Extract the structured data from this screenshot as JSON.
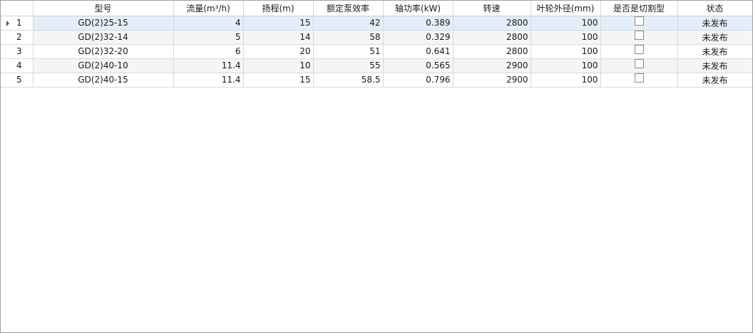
{
  "columns": [
    "",
    "型号",
    "流量(m³/h)",
    "扬程(m)",
    "额定泵效率",
    "轴功率(kW)",
    "转速",
    "叶轮外径(mm)",
    "是否是切割型",
    "状态"
  ],
  "rows": [
    {
      "index": "1",
      "model": "GD(2)25-15",
      "flow": "4",
      "head": "15",
      "efficiency": "42",
      "power": "0.389",
      "speed": "2800",
      "diameter": "100",
      "is_cut": false,
      "status": "未发布"
    },
    {
      "index": "2",
      "model": "GD(2)32-14",
      "flow": "5",
      "head": "14",
      "efficiency": "58",
      "power": "0.329",
      "speed": "2800",
      "diameter": "100",
      "is_cut": false,
      "status": "未发布"
    },
    {
      "index": "3",
      "model": "GD(2)32-20",
      "flow": "6",
      "head": "20",
      "efficiency": "51",
      "power": "0.641",
      "speed": "2800",
      "diameter": "100",
      "is_cut": false,
      "status": "未发布"
    },
    {
      "index": "4",
      "model": "GD(2)40-10",
      "flow": "11.4",
      "head": "10",
      "efficiency": "55",
      "power": "0.565",
      "speed": "2900",
      "diameter": "100",
      "is_cut": false,
      "status": "未发布"
    },
    {
      "index": "5",
      "model": "GD(2)40-15",
      "flow": "11.4",
      "head": "15",
      "efficiency": "58.5",
      "power": "0.796",
      "speed": "2900",
      "diameter": "100",
      "is_cut": false,
      "status": "未发布"
    }
  ],
  "selected_row": 0
}
